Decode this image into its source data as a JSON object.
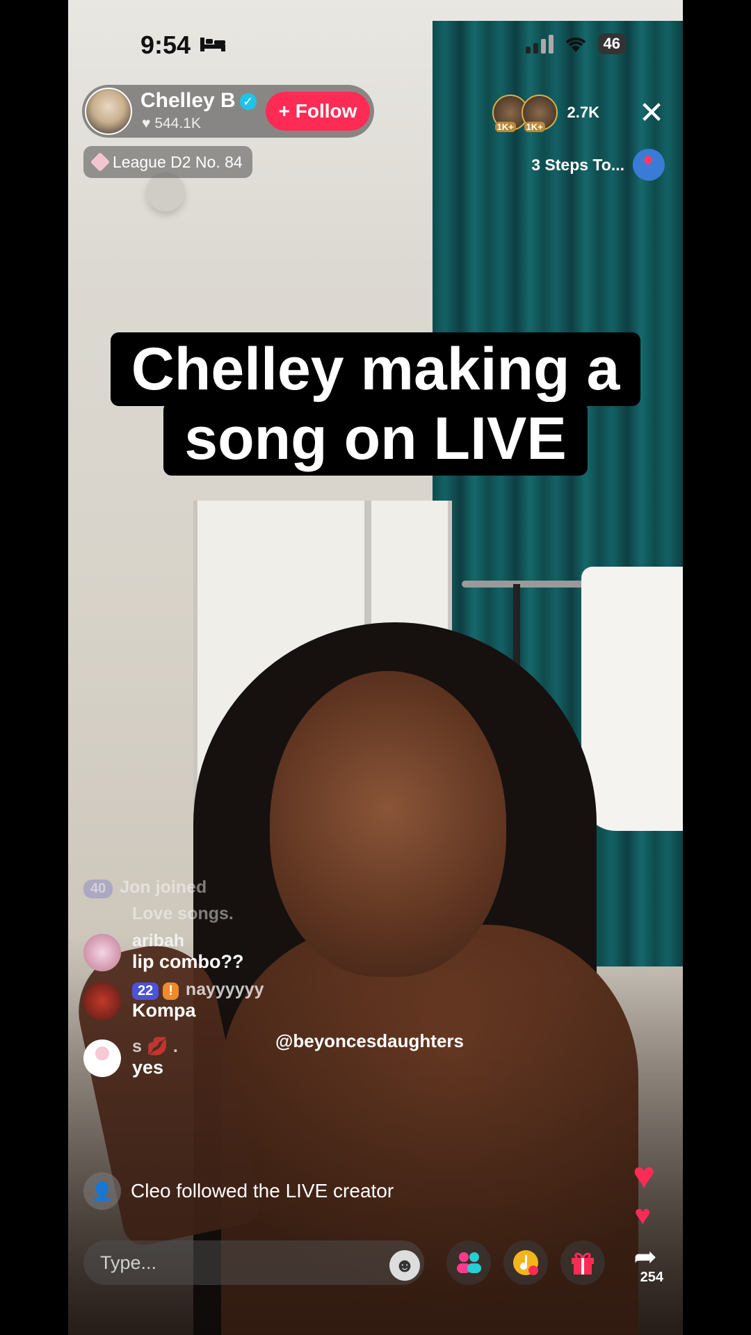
{
  "status_bar": {
    "time": "9:54",
    "battery": "46"
  },
  "host": {
    "name": "Chelley B",
    "likes": "544.1K",
    "follow_label": "+ Follow"
  },
  "league": {
    "label": "League D2 No. 84"
  },
  "viewers": {
    "badge_1": "1K+",
    "badge_2": "1K+",
    "count": "2.7K"
  },
  "close_label": "✕",
  "promo": {
    "label": "3 Steps To..."
  },
  "caption": {
    "line1": "Chelley making a",
    "line2": "song on LIVE"
  },
  "chat": {
    "faded_level": "40",
    "faded_join": "Jon joined",
    "faded_text": "Love songs.",
    "messages": [
      {
        "user": "aribah",
        "text": "lip combo??"
      },
      {
        "level": "22",
        "user": "nayyyyyy",
        "text": "Kompa"
      },
      {
        "user": "s 💋 .",
        "text": "yes"
      }
    ],
    "mention": "@beyoncesdaughters",
    "follow_note": "Cleo followed the LIVE creator"
  },
  "composer": {
    "placeholder": "Type..."
  },
  "share_count": "254",
  "icons": [
    "bed-icon",
    "signal-icon",
    "wifi-icon",
    "battery-icon",
    "verified-icon",
    "heart-icon",
    "diamond-icon",
    "close-icon",
    "emoji-icon",
    "guests-icon",
    "music-icon",
    "gift-icon",
    "share-icon",
    "follow-note-icon"
  ]
}
